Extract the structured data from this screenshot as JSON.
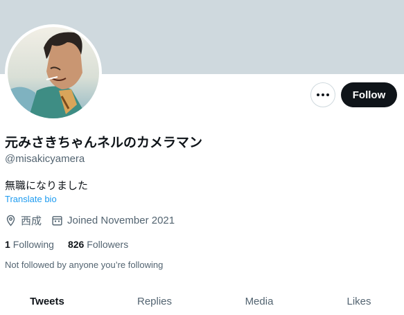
{
  "profile": {
    "display_name": "元みさきちゃんネルのカメラマン",
    "handle": "@misakicyamera",
    "bio": "無職になりました",
    "translate_label": "Translate bio",
    "location": "西成",
    "joined": "Joined November 2021"
  },
  "actions": {
    "follow_label": "Follow",
    "more_icon": "more-horizontal-icon"
  },
  "stats": {
    "following_count": "1",
    "following_label": "Following",
    "followers_count": "826",
    "followers_label": "Followers"
  },
  "followed_by_text": "Not followed by anyone you’re following",
  "tabs": [
    {
      "label": "Tweets",
      "active": true
    },
    {
      "label": "Replies",
      "active": false
    },
    {
      "label": "Media",
      "active": false
    },
    {
      "label": "Likes",
      "active": false
    }
  ],
  "colors": {
    "banner": "#cfd9de",
    "primary_text": "#0f1419",
    "secondary_text": "#536471",
    "link": "#1d9bf0",
    "follow_button": "#0f1419"
  },
  "icons": {
    "location": "location-pin-icon",
    "calendar": "calendar-icon"
  }
}
